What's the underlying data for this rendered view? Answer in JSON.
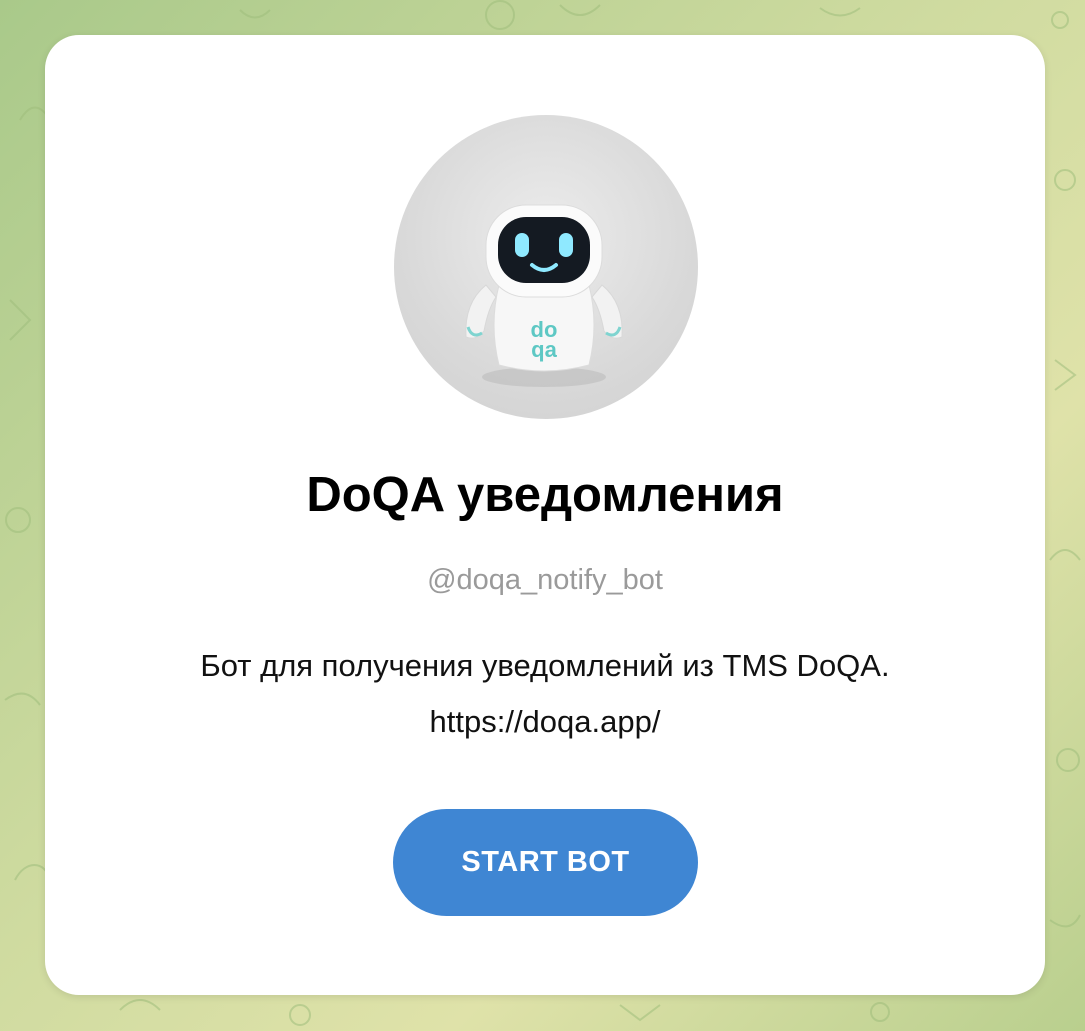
{
  "bot": {
    "name": "DoQA уведомления",
    "username": "@doqa_notify_bot",
    "description_line1": "Бот для получения уведомлений из TMS DoQA.",
    "description_line2": "https://doqa.app/",
    "avatar_icon": "robot-avatar-icon"
  },
  "actions": {
    "start_label": "START BOT"
  },
  "colors": {
    "background_pattern": "#b9cf8e",
    "card": "#ffffff",
    "button": "#3f86d3",
    "username_text": "#9a9a9a"
  }
}
